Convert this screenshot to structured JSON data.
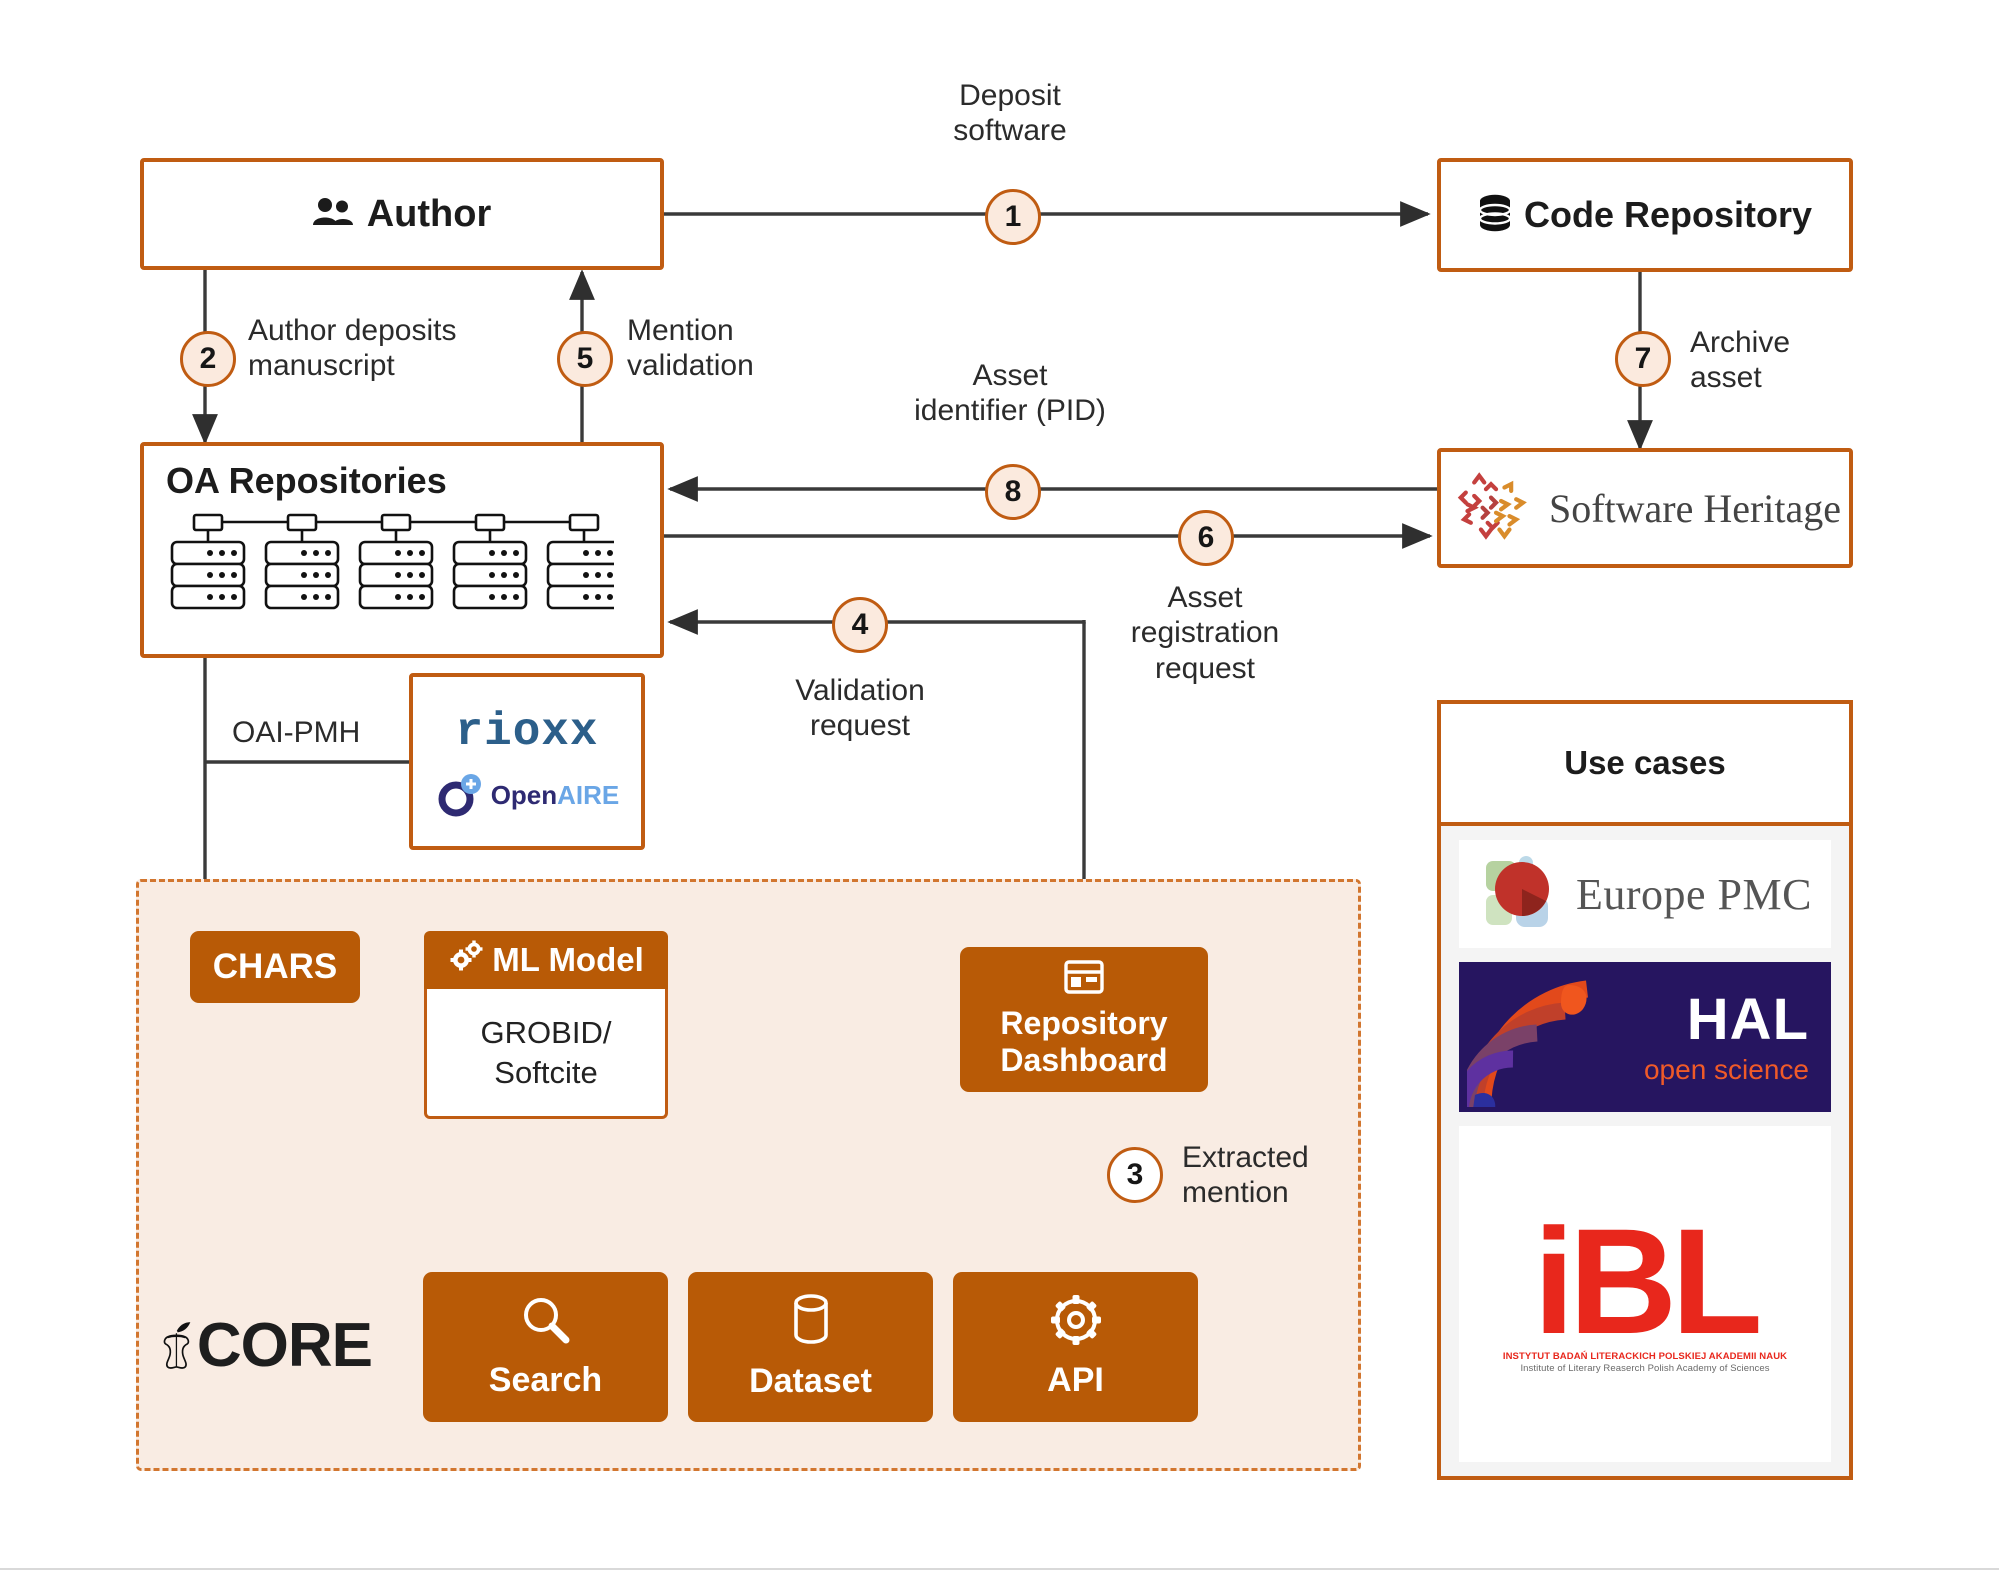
{
  "nodes": {
    "author": {
      "label": "Author",
      "icon": "people-icon"
    },
    "code_repository": {
      "label": "Code Repository",
      "icon": "database-icon"
    },
    "oa_repositories": {
      "label": "OA Repositories",
      "icon": "server-rack-icon"
    },
    "software_heritage": {
      "label": "Software Heritage",
      "icon": "software-heritage-logo"
    },
    "chars": {
      "label": "CHARS"
    },
    "ml_model": {
      "label": "ML Model",
      "sub": "GROBID/\nSoftcite",
      "sub_line1": "GROBID/",
      "sub_line2": "Softcite",
      "icon": "gears-icon"
    },
    "repository_dashboard": {
      "label_line1": "Repository",
      "label_line2": "Dashboard",
      "icon": "dashboard-icon"
    },
    "search": {
      "label": "Search",
      "icon": "magnifier-icon"
    },
    "dataset": {
      "label": "Dataset",
      "icon": "cylinder-icon"
    },
    "api": {
      "label": "API",
      "icon": "gear-icon"
    },
    "core": {
      "label": "CORE",
      "icon": "apple-core-icon"
    },
    "rioxx": {
      "label": "rioxx",
      "openaire_open": "Open",
      "openaire_aire": "AIRE"
    }
  },
  "edges": {
    "e1": {
      "number": "1",
      "label_line1": "Deposit",
      "label_line2": "software"
    },
    "e2": {
      "number": "2",
      "label_line1": "Author deposits",
      "label_line2": "manuscript"
    },
    "e3": {
      "number": "3",
      "label_line1": "Extracted",
      "label_line2": "mention"
    },
    "e4": {
      "number": "4",
      "label_line1": "Validation",
      "label_line2": "request"
    },
    "e5": {
      "number": "5",
      "label_line1": "Mention",
      "label_line2": "validation"
    },
    "e6": {
      "number": "6",
      "label_line1": "Asset",
      "label_line2": "registration",
      "label_line3": "request"
    },
    "e7": {
      "number": "7",
      "label_line1": "Archive",
      "label_line2": "asset"
    },
    "e8": {
      "number": "8",
      "label_line1": "Asset",
      "label_line2": "identifier (PID)"
    },
    "oaipmh": {
      "label": "OAI-PMH"
    }
  },
  "use_cases": {
    "title": "Use cases",
    "items": [
      {
        "name": "Europe PMC",
        "text": "Europe PMC"
      },
      {
        "name": "HAL",
        "line1": "HAL",
        "line2": "open science"
      },
      {
        "name": "IBL",
        "letters": "iBL",
        "sub_pl": "INSTYTUT BADAŃ LITERACKICH POLSKIEJ AKADEMII NAUK",
        "sub_en": "Institute of Literary Reaserch Polish Academy of Sciences"
      }
    ]
  },
  "colors": {
    "accent_orange": "#b85a06",
    "border_orange": "#c05c12",
    "core_bg": "#f9ece3",
    "number_bg": "#fbeade",
    "edge_gray": "#3a3a3a"
  }
}
